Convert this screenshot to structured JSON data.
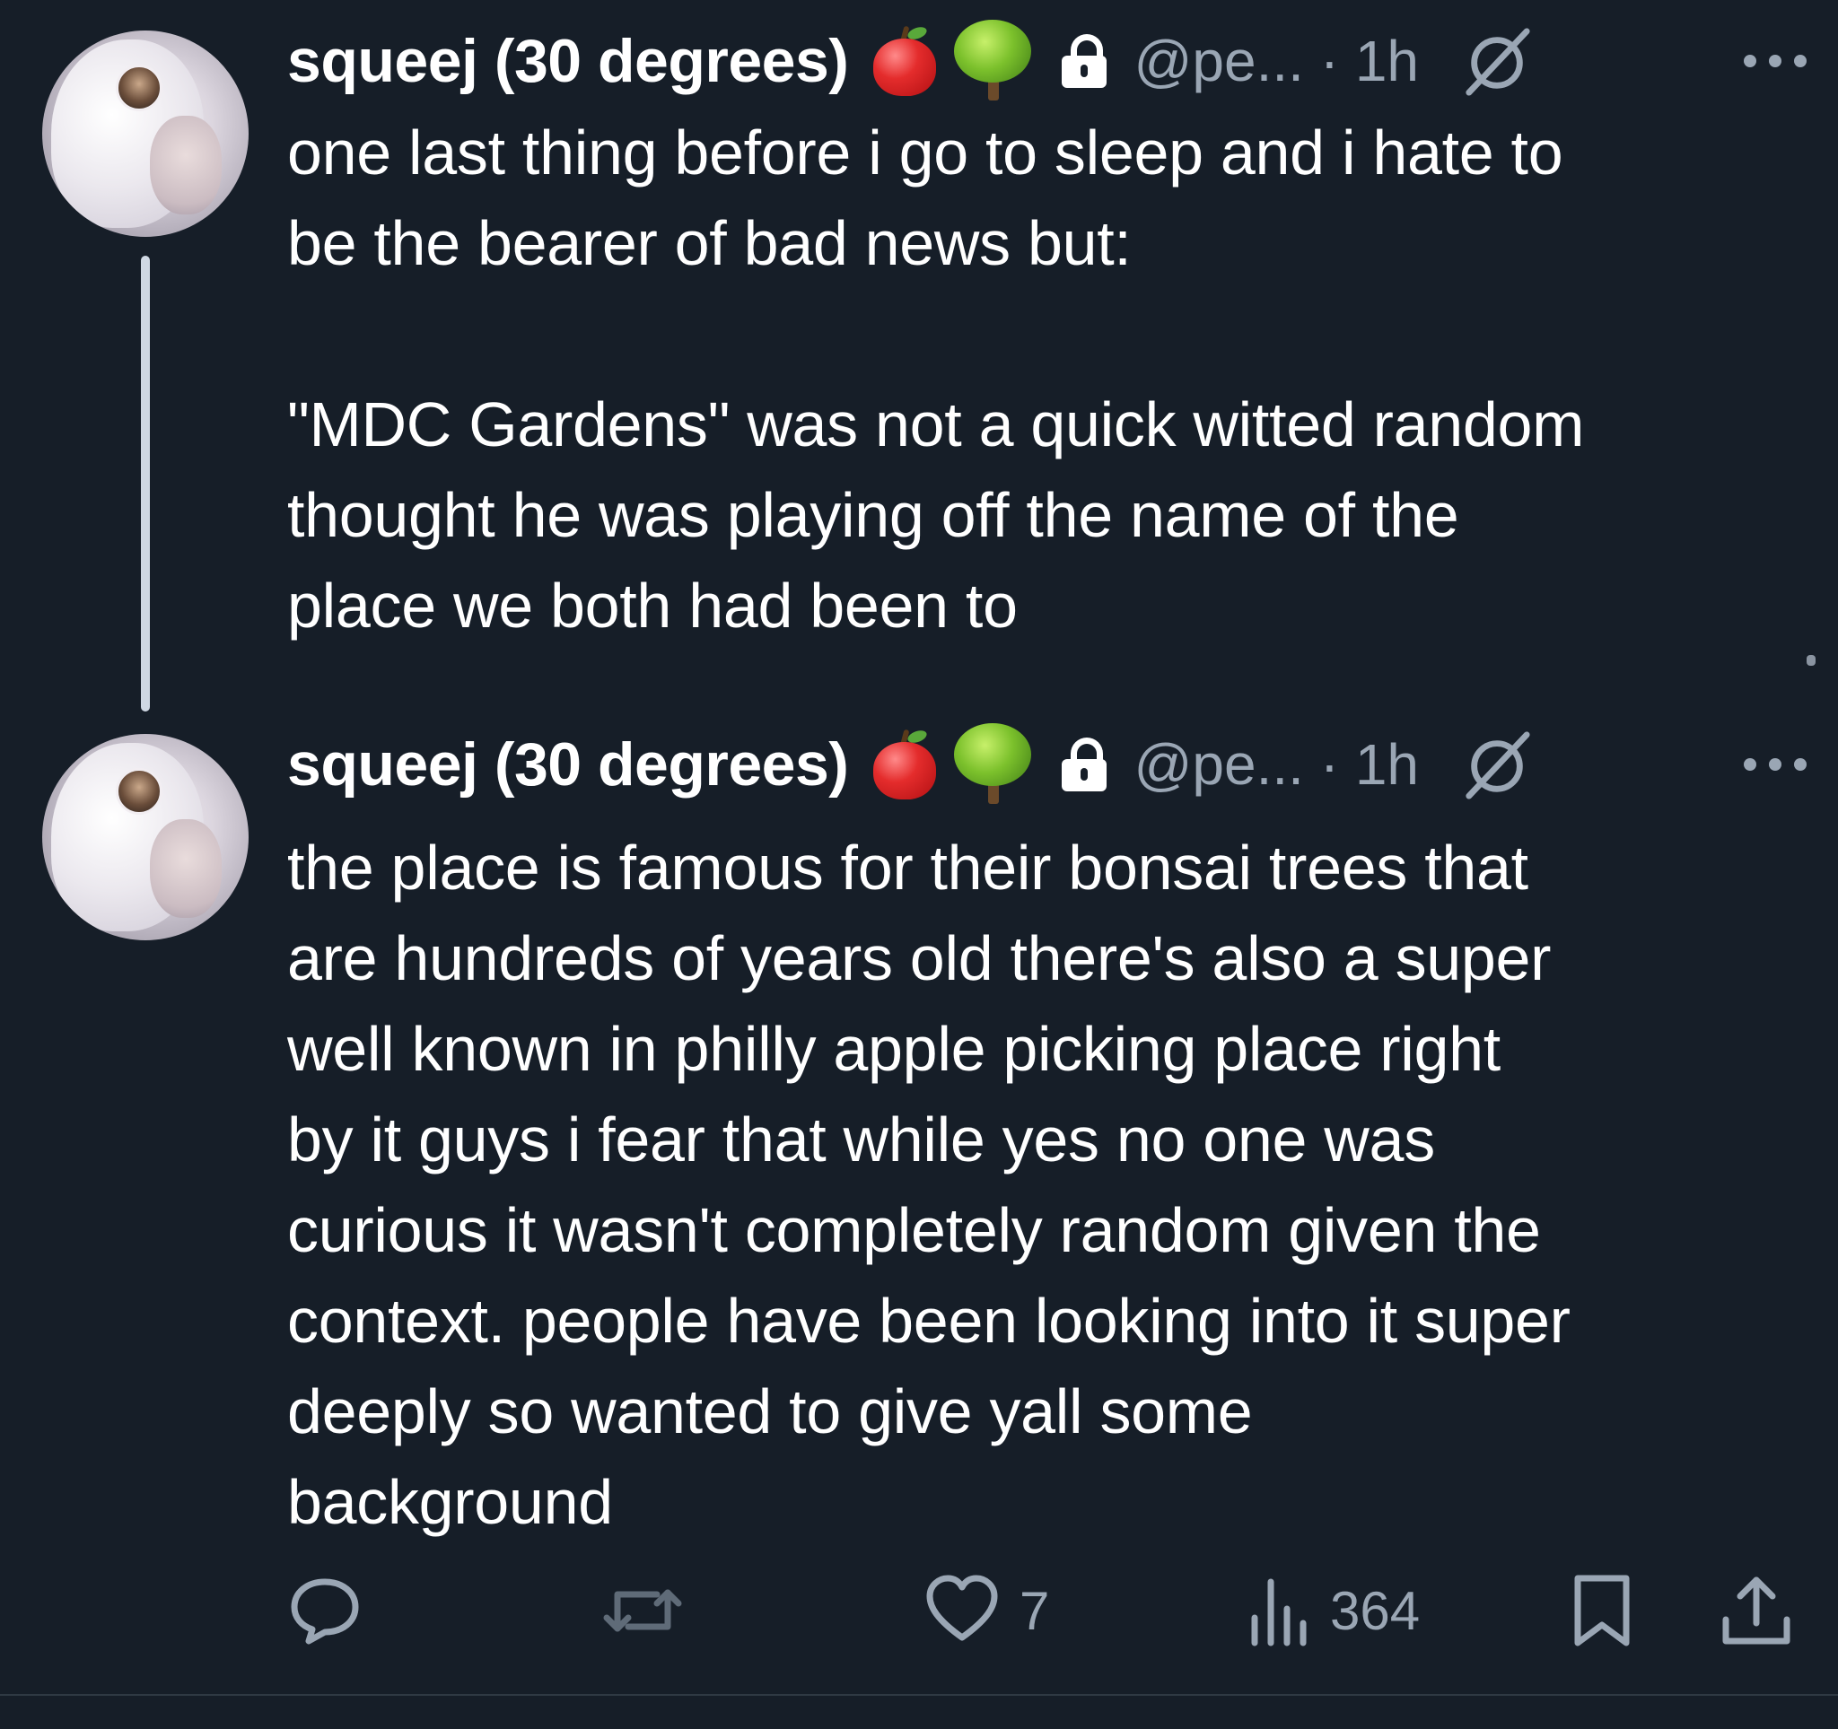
{
  "tweets": [
    {
      "author_name": "squeej (30 degrees)",
      "emoji_1": "red-apple",
      "emoji_2": "tree",
      "handle": "@pe...",
      "separator": "·",
      "time": "1h",
      "text": "one last thing before i go to sleep and i hate to\nbe the bearer of bad news but:\n\n\"MDC Gardens\" was not a quick witted random\nthought he was playing off the name of the\nplace we both had been to"
    },
    {
      "author_name": "squeej (30 degrees)",
      "emoji_1": "red-apple",
      "emoji_2": "tree",
      "handle": "@pe...",
      "separator": "·",
      "time": "1h",
      "text": "the place is famous for their bonsai trees that\nare hundreds of years old there's also a super\nwell known in philly apple picking place right\nby it guys i fear that while yes no one was\ncurious it wasn't completely random given the\ncontext. people have been looking into it super\ndeeply so wanted to give yall some\nbackground",
      "actions": {
        "reply_count": "",
        "retweet_count": "",
        "like_count": "7",
        "view_count": "364"
      }
    }
  ],
  "colors": {
    "background": "#161e28",
    "text": "#ffffff",
    "secondary": "#9aa6b4",
    "thread_line": "#cfd8e3"
  }
}
